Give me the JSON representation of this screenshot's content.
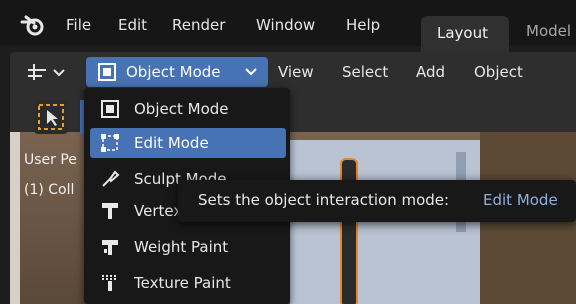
{
  "topbar": {
    "menus": [
      "File",
      "Edit",
      "Render",
      "Window",
      "Help"
    ],
    "tabs": [
      {
        "label": "Layout",
        "active": true
      },
      {
        "label": "Model",
        "active": false
      }
    ]
  },
  "header": {
    "mode_dropdown_label": "Object Mode",
    "menus": [
      "View",
      "Select",
      "Add",
      "Object"
    ]
  },
  "viewport": {
    "overlay_line1": "User Pe",
    "overlay_line2": "(1) Coll"
  },
  "mode_menu": {
    "items": [
      {
        "label": "Object Mode",
        "icon": "object-mode-icon",
        "selected": false
      },
      {
        "label": "Edit Mode",
        "icon": "edit-mode-icon",
        "selected": true
      },
      {
        "label": "Sculpt Mode",
        "icon": "sculpt-mode-icon",
        "selected": false
      },
      {
        "label": "Vertex Paint",
        "icon": "vertex-paint-icon",
        "selected": false
      },
      {
        "label": "Weight Paint",
        "icon": "weight-paint-icon",
        "selected": false
      },
      {
        "label": "Texture Paint",
        "icon": "texture-paint-icon",
        "selected": false
      }
    ]
  },
  "tooltip": {
    "description": "Sets the object interaction mode:",
    "value": "Edit Mode"
  },
  "colors": {
    "accent": "#4772b3",
    "menu_bg": "#181818",
    "topbar_bg": "#161616",
    "header_bg": "#2e2e2e",
    "tooltip_value": "#8fb0e0",
    "selection_outline": "#e8862a"
  }
}
